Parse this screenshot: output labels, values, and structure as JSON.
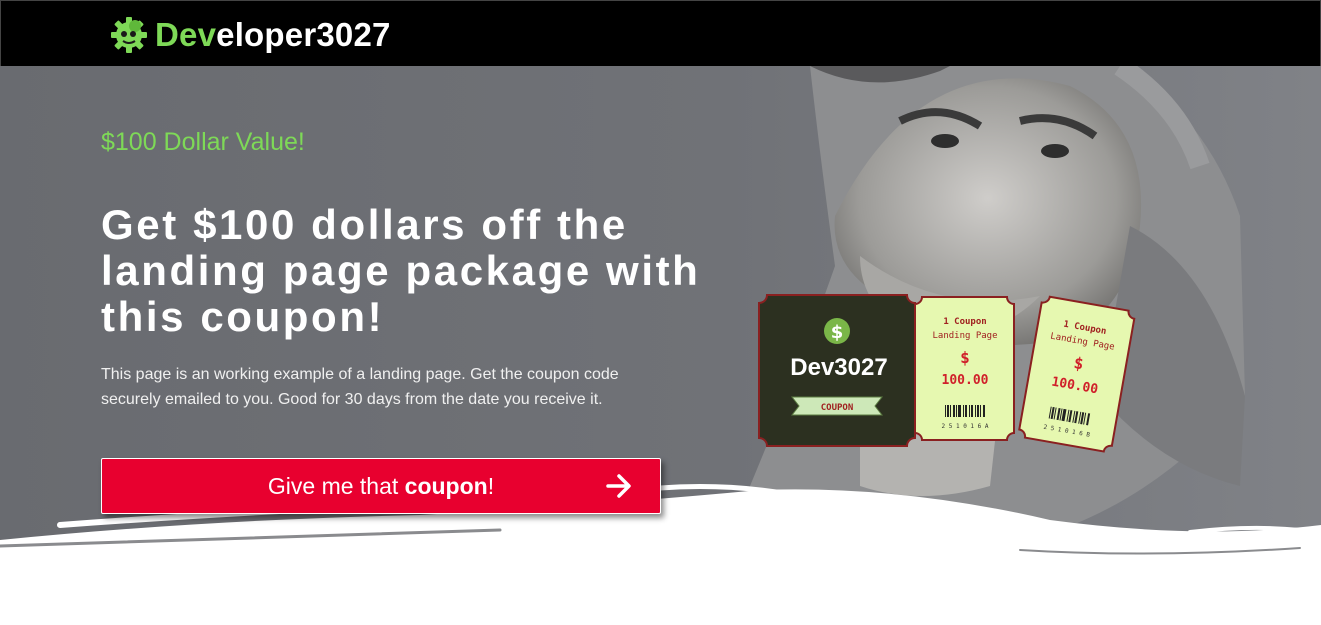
{
  "brand": {
    "logo_accent": "Dev",
    "logo_rest": "eloper3027",
    "accent_color": "#7ed957"
  },
  "hero": {
    "eyebrow": "$100 Dollar Value!",
    "headline": "Get $100 dollars off the landing page package with this coupon!",
    "body": "This page is an working example of a landing page. Get the coupon code securely emailed to you. Good for 30 days from the date you receive it."
  },
  "cta": {
    "label_prefix": "Give me that",
    "label_bold": "coupon",
    "label_suffix": "!",
    "color": "#e8002f"
  },
  "coupon_graphic": {
    "main": {
      "title": "Dev3027",
      "ribbon": "COUPON",
      "dollar_sign": "$"
    },
    "tickets": [
      {
        "line1": "1 Coupon",
        "line2": "Landing Page",
        "currency": "$",
        "amount": "100.00",
        "serial": "2 5 1 0 1 6 A"
      },
      {
        "line1": "1 Coupon",
        "line2": "Landing Page",
        "currency": "$",
        "amount": "100.00",
        "serial": "2 5 1 0 1 6 B"
      }
    ]
  }
}
